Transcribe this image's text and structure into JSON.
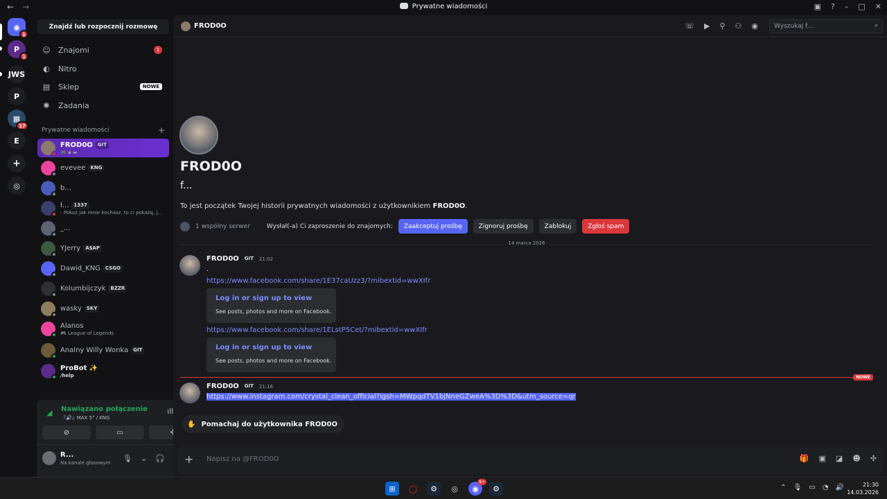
{
  "window": {
    "title": "Prywatne wiadomości"
  },
  "servers": [
    {
      "label": "",
      "badge": "1"
    },
    {
      "label": "",
      "badge": "1"
    },
    {
      "label": "JWS",
      "badge": ""
    },
    {
      "label": "P",
      "badge": ""
    },
    {
      "label": "",
      "badge": "17"
    },
    {
      "label": "E",
      "badge": ""
    }
  ],
  "sidebar": {
    "find_label": "Znajdź lub rozpocznij rozmowę",
    "nav": [
      {
        "label": "Znajomi",
        "badge": "1"
      },
      {
        "label": "Nitro",
        "badge": ""
      },
      {
        "label": "Sklep",
        "badge": "NOWE"
      },
      {
        "label": "Zadania",
        "badge": ""
      }
    ],
    "dm_header": "Prywatne wiadomości",
    "dms": [
      {
        "name": "FROD0O",
        "tag": "GIT",
        "sub": ""
      },
      {
        "name": "evevee",
        "tag": "KNG",
        "sub": ""
      },
      {
        "name": "b...",
        "tag": "",
        "sub": ""
      },
      {
        "name": "ł...",
        "tag": "1337",
        "sub": "- Pokaż jak mnie kochasz, to ci pokażę, j..."
      },
      {
        "name": "_...",
        "tag": "",
        "sub": ""
      },
      {
        "name": "YJerry",
        "tag": "A$AP",
        "sub": ""
      },
      {
        "name": "Dawid_KNG",
        "tag": "CSGO",
        "sub": ""
      },
      {
        "name": "Kolumbijczyk",
        "tag": "BZZR",
        "sub": ""
      },
      {
        "name": "wasky",
        "tag": "SKY",
        "sub": ""
      },
      {
        "name": "Alanos",
        "tag": "",
        "sub": "League of Legends"
      },
      {
        "name": "Analny Willy Wonka",
        "tag": "GIT",
        "sub": ""
      },
      {
        "name": "ProBot ✨",
        "tag": "",
        "sub": "/help"
      }
    ]
  },
  "voice": {
    "status": "Nawiązano połączenie",
    "channel": "『🔊』MAX 5° / KNG",
    "user_name": "R...",
    "user_status": "Na kanale głosowym"
  },
  "chat": {
    "header_name": "FROD0O",
    "search_placeholder": "Wyszukaj f...",
    "intro_name": "FROD0O",
    "intro_handle": "f...",
    "intro_text_prefix": "To jest początek Twojej historii prywatnych wiadomości z użytkownikiem ",
    "intro_text_name": "FROD0O",
    "intro_text_suffix": ".",
    "mutual_servers": "1 wspólny serwer",
    "invite_text": "Wysłał(-a) Ci zaproszenie do znajomych:",
    "accept": "Zaakceptuj prośbę",
    "ignore": "Zignoruj prośbę",
    "block": "Zablokuj",
    "spam": "Zgłoś spam",
    "date": "14 marca 2026",
    "new_label": "NOWE",
    "messages": [
      {
        "author": "FROD0O",
        "tag": "GIT",
        "time": "21:02"
      },
      {
        "author": "FROD0O",
        "tag": "GIT",
        "time": "21:16"
      }
    ],
    "msg1_dot": ".",
    "link1": "https://www.facebook.com/share/1E37caUzz3/?mibextid=wwXIfr",
    "link2": "https://www.facebook.com/share/1ELstP5Cet/?mibextid=wwXIfr",
    "embed_title": "Log in or sign up to view",
    "embed_desc": "See posts, photos and more on Facebook.",
    "link3": "https://www.instagram.com/crystal_clean_official?igsh=MWpqdTV1bjNneGZweA%3D%3D&utm_source=qr",
    "wave_label": "Pomachaj do użytkownika FROD0O",
    "composer_placeholder": "Napisz na @FROD0O"
  },
  "taskbar": {
    "time": "21:30",
    "date": "14.03.2026",
    "app_badge": "9+"
  },
  "colors": {
    "accent": "#5865f2",
    "danger": "#da373c",
    "online": "#23a55a",
    "active_dm": "#6c2ed1"
  }
}
